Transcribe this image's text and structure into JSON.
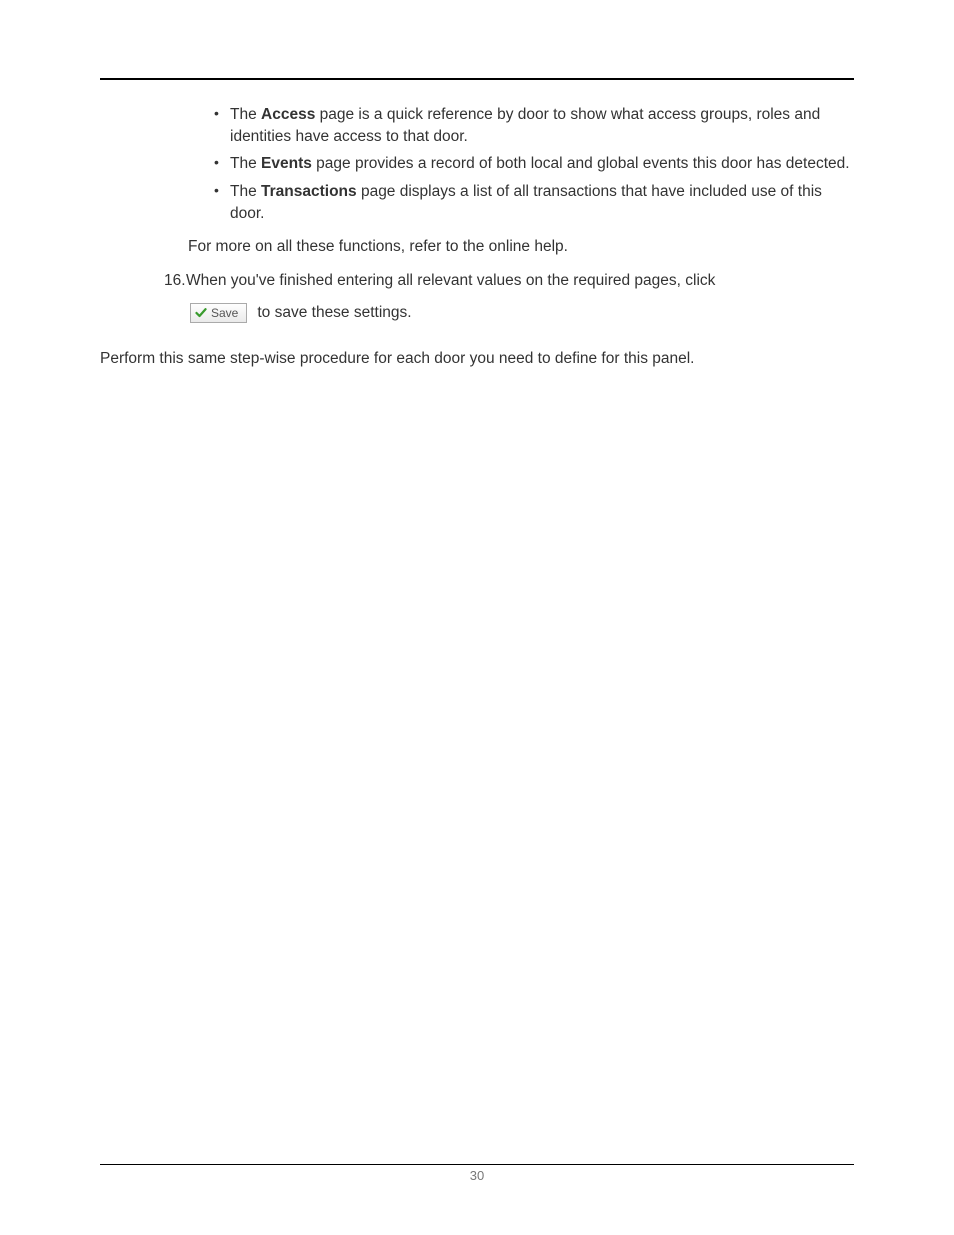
{
  "bullets": [
    {
      "pre": "The ",
      "bold": "Access",
      "post": " page is a quick reference by door to show what access groups, roles and identities have access to that door."
    },
    {
      "pre": "The ",
      "bold": "Events",
      "post": " page provides a record of both local and global events this door has detected."
    },
    {
      "pre": "The ",
      "bold": "Transactions",
      "post": " page displays a list of all transactions that have included use of this door."
    }
  ],
  "ref_line": "For more on all these functions, refer to the online help.",
  "step": {
    "num": "16.",
    "text": "When you've finished entering all relevant values on the required pages, click"
  },
  "save_button_label": "Save",
  "save_suffix": " to save these settings.",
  "closing": "Perform this same step-wise procedure for each door you need to define for this panel.",
  "page_number": "30"
}
